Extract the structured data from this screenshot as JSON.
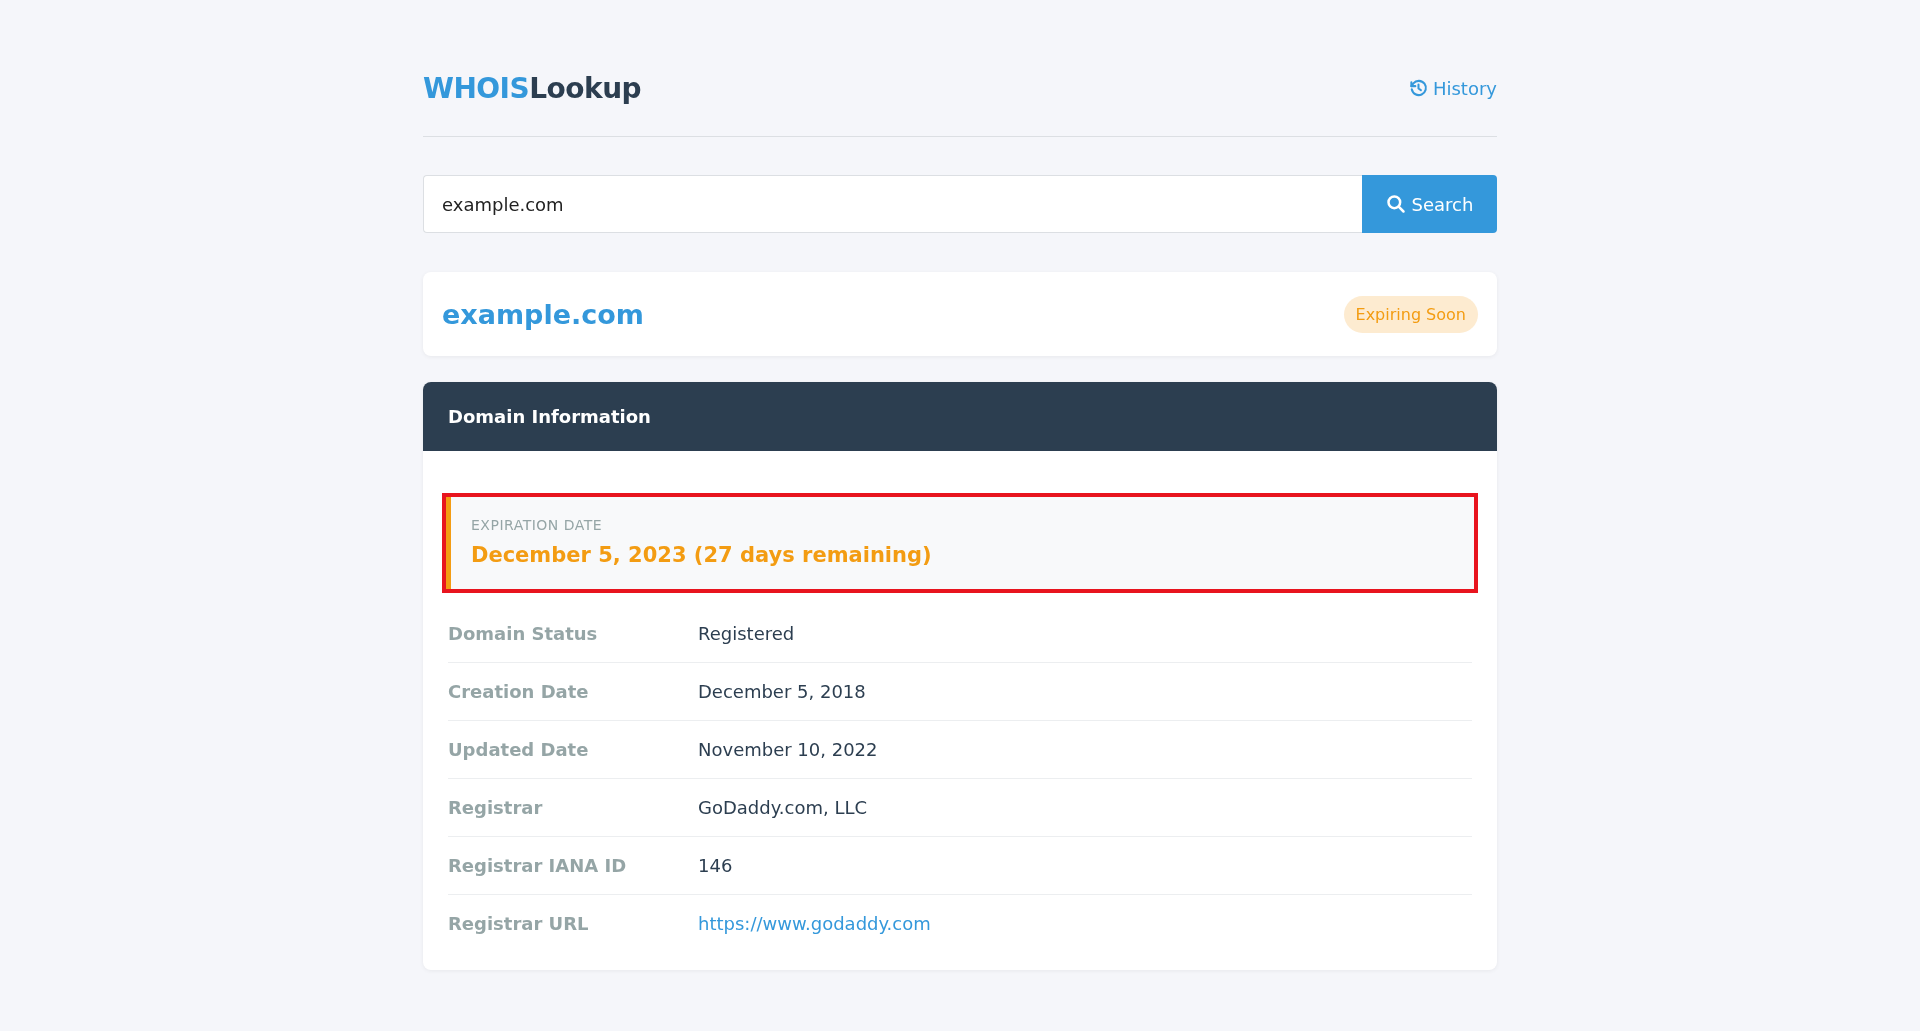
{
  "logo": {
    "first": "WHOIS",
    "second": "Lookup"
  },
  "history_link": "History",
  "search": {
    "value": "example.com",
    "button": "Search"
  },
  "domain": {
    "name": "example.com",
    "badge": "Expiring Soon"
  },
  "panel": {
    "title": "Domain Information",
    "expiration": {
      "label": "EXPIRATION DATE",
      "value": "December 5, 2023 (27 days remaining)",
      "highlighted": true
    },
    "rows": [
      {
        "label": "Domain Status",
        "value": "Registered",
        "kind": "text"
      },
      {
        "label": "Creation Date",
        "value": "December 5, 2018",
        "kind": "text"
      },
      {
        "label": "Updated Date",
        "value": "November 10, 2022",
        "kind": "text"
      },
      {
        "label": "Registrar",
        "value": "GoDaddy.com, LLC",
        "kind": "text"
      },
      {
        "label": "Registrar IANA ID",
        "value": "146",
        "kind": "text"
      },
      {
        "label": "Registrar URL",
        "value": "https://www.godaddy.com",
        "kind": "link"
      }
    ]
  }
}
